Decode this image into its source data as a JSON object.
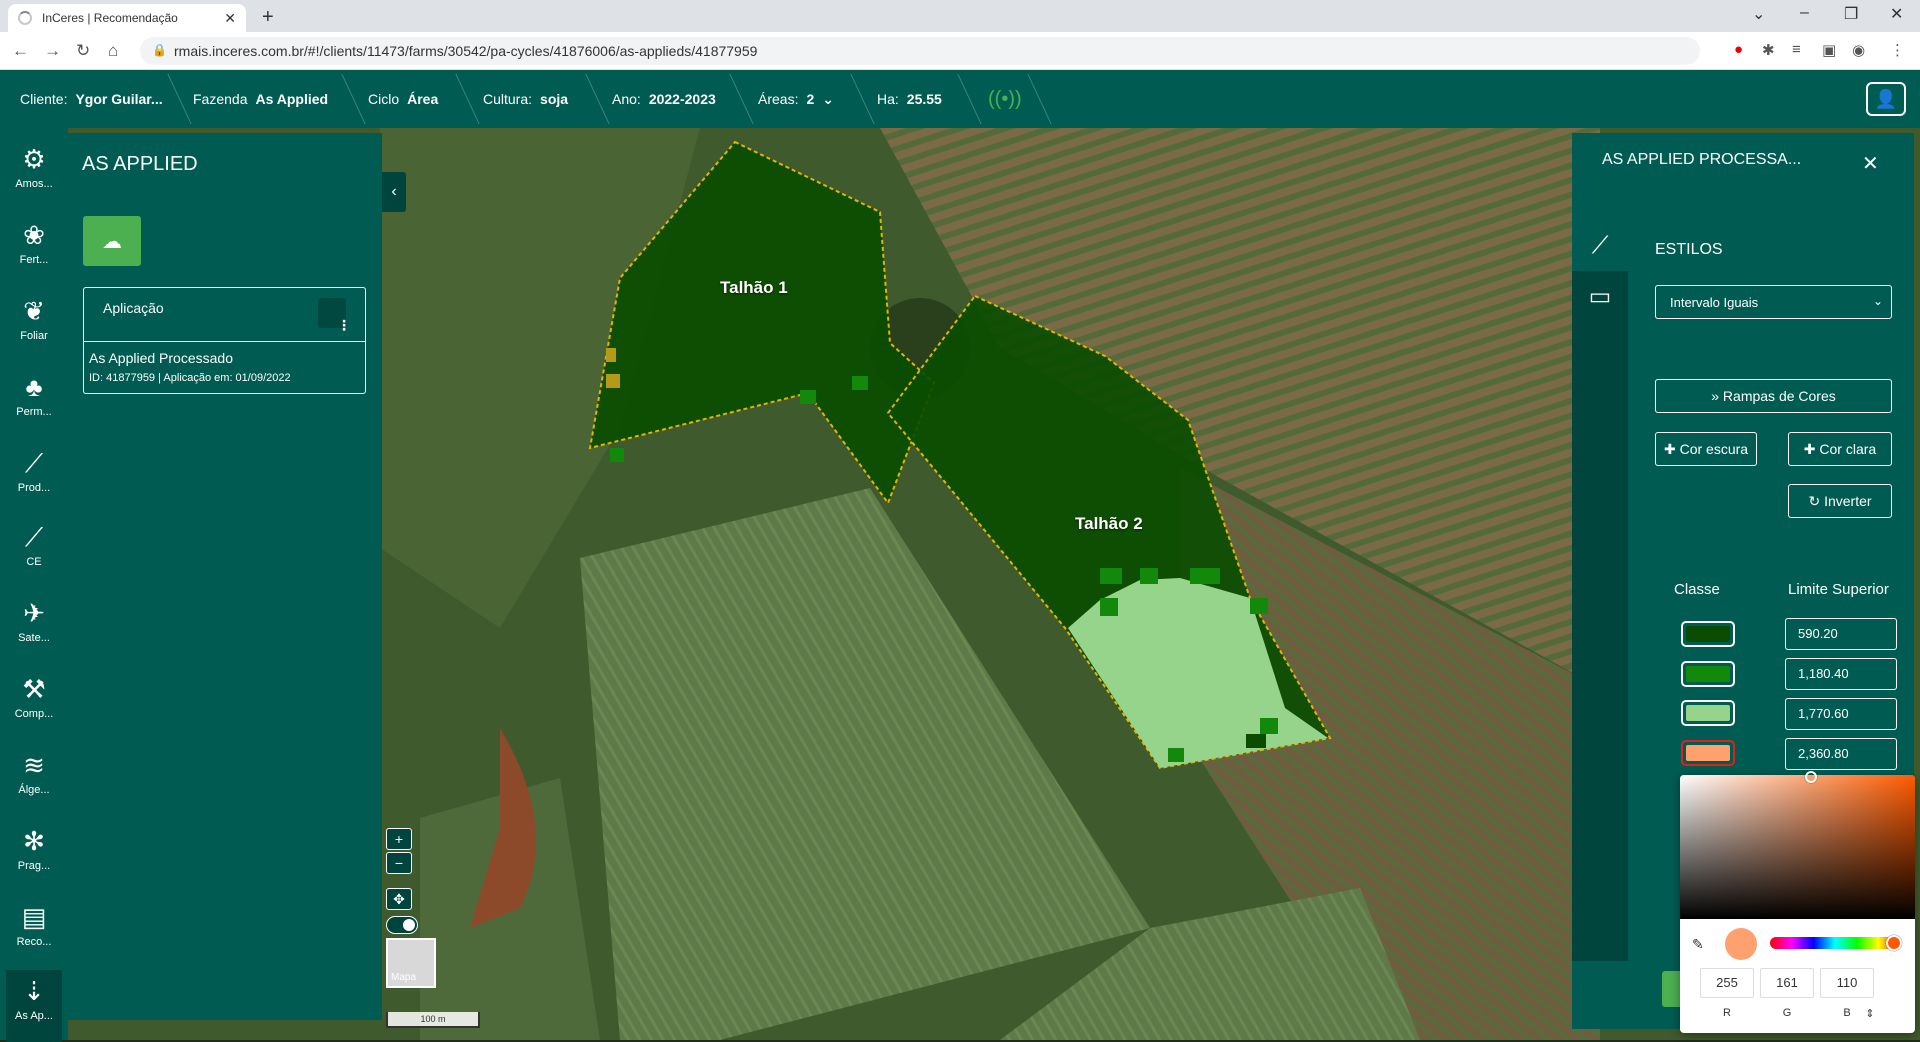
{
  "browser": {
    "tab_title": "InCeres | Recomendação",
    "url": "rmais.inceres.com.br/#!/clients/11473/farms/30542/pa-cycles/41876006/as-applieds/41877959"
  },
  "header": {
    "cliente_label": "Cliente:",
    "cliente_value": "Ygor Guilar...",
    "fazenda_label": "Fazenda",
    "fazenda_value": "As Applied",
    "ciclo_label": "Ciclo",
    "ciclo_value": "Área",
    "cultura_label": "Cultura:",
    "cultura_value": "soja",
    "ano_label": "Ano:",
    "ano_value": "2022-2023",
    "areas_label": "Áreas:",
    "areas_value": "2",
    "ha_label": "Ha:",
    "ha_value": "25.55"
  },
  "sidebar": {
    "items": [
      {
        "label": "Amos...",
        "icon": "sampling-icon"
      },
      {
        "label": "Fert...",
        "icon": "fertilizer-icon"
      },
      {
        "label": "Foliar",
        "icon": "leaf-icon"
      },
      {
        "label": "Perm...",
        "icon": "permission-icon"
      },
      {
        "label": "Prod...",
        "icon": "productivity-chart-icon"
      },
      {
        "label": "CE",
        "icon": "ce-chart-icon"
      },
      {
        "label": "Sate...",
        "icon": "satellite-icon"
      },
      {
        "label": "Comp...",
        "icon": "compaction-icon"
      },
      {
        "label": "Álge...",
        "icon": "layers-icon"
      },
      {
        "label": "Prag...",
        "icon": "bug-icon"
      },
      {
        "label": "Reco...",
        "icon": "recommendation-icon"
      },
      {
        "label": "As Ap...",
        "icon": "as-applied-icon"
      }
    ]
  },
  "left_panel": {
    "title": "AS APPLIED",
    "card_header": "Aplicação",
    "item_title": "As Applied Processado",
    "item_details": "ID: 41877959 | Aplicação em: 01/09/2022"
  },
  "map": {
    "field1_label": "Talhão 1",
    "field2_label": "Talhão 2",
    "thumb_label": "Mapa",
    "scale_label": "100 m",
    "zoom_in": "+",
    "zoom_out": "−"
  },
  "right_panel": {
    "title": "AS APPLIED PROCESSA...",
    "section": "ESTILOS",
    "select_value": "Intervalo Iguais",
    "ramps_label": "Rampas de Cores",
    "dark_label": "Cor escura",
    "light_label": "Cor clara",
    "invert_label": "Inverter",
    "col_class": "Classe",
    "col_limit": "Limite Superior",
    "classes": [
      {
        "color": "#0a4d00",
        "limit": "590.20"
      },
      {
        "color": "#12890b",
        "limit": "1,180.40"
      },
      {
        "color": "#96d48c",
        "limit": "1,770.60"
      },
      {
        "color": "#ffa16e",
        "limit": "2,360.80"
      }
    ]
  },
  "color_picker": {
    "r": "255",
    "g": "161",
    "b": "110",
    "r_label": "R",
    "g_label": "G",
    "b_label": "B"
  }
}
